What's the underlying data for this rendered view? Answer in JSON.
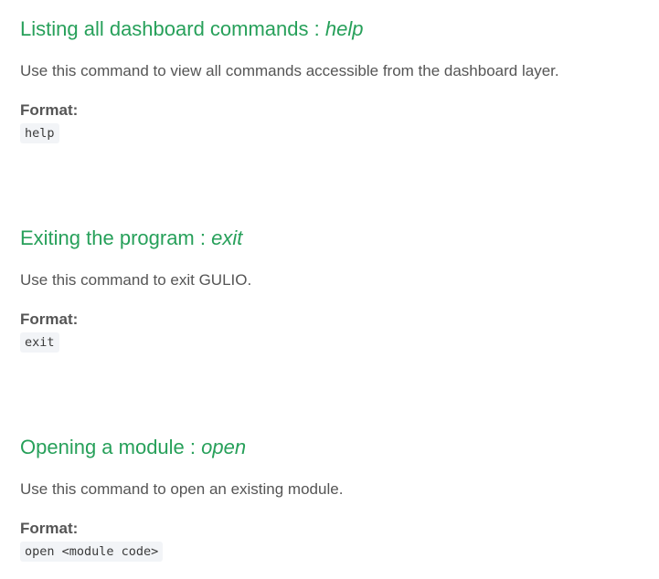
{
  "sections": [
    {
      "title": "Listing all dashboard commands : ",
      "command": "help",
      "description": "Use this command to view all commands accessible from the dashboard layer.",
      "format_label": "Format:",
      "format_code": "help"
    },
    {
      "title": "Exiting the program : ",
      "command": "exit",
      "description": "Use this command to exit GULIO.",
      "format_label": "Format:",
      "format_code": "exit"
    },
    {
      "title": "Opening a module : ",
      "command": "open",
      "description": "Use this command to open an existing module.",
      "format_label": "Format:",
      "format_code": "open <module code>"
    }
  ],
  "colors": {
    "heading": "#27a05a",
    "text": "#555555",
    "code_background": "#f2f4f7"
  }
}
